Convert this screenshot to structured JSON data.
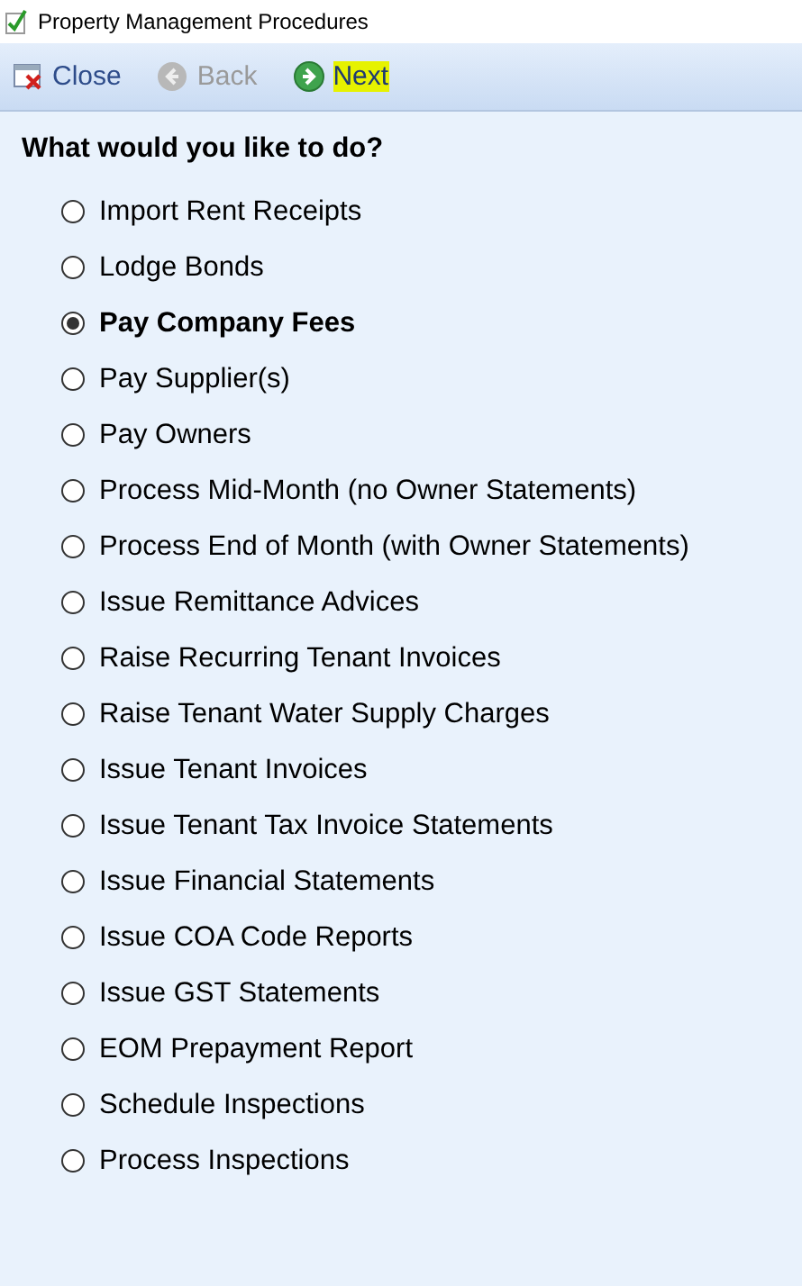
{
  "window": {
    "title": "Property Management Procedures"
  },
  "toolbar": [
    {
      "kind": "close",
      "label": "Close",
      "disabled": false,
      "highlighted": false
    },
    {
      "kind": "back",
      "label": "Back",
      "disabled": true,
      "highlighted": false
    },
    {
      "kind": "next",
      "label": "Next",
      "disabled": false,
      "highlighted": true
    }
  ],
  "heading": "What would you like to do?",
  "options": [
    {
      "label": "Import Rent Receipts",
      "selected": false
    },
    {
      "label": "Lodge Bonds",
      "selected": false
    },
    {
      "label": "Pay Company Fees",
      "selected": true
    },
    {
      "label": "Pay Supplier(s)",
      "selected": false
    },
    {
      "label": "Pay Owners",
      "selected": false
    },
    {
      "label": "Process Mid-Month (no Owner Statements)",
      "selected": false
    },
    {
      "label": "Process End of Month (with Owner Statements)",
      "selected": false
    },
    {
      "label": "Issue Remittance Advices",
      "selected": false
    },
    {
      "label": "Raise Recurring Tenant Invoices",
      "selected": false
    },
    {
      "label": "Raise Tenant Water Supply Charges",
      "selected": false
    },
    {
      "label": "Issue Tenant Invoices",
      "selected": false
    },
    {
      "label": "Issue Tenant Tax Invoice Statements",
      "selected": false
    },
    {
      "label": "Issue Financial Statements",
      "selected": false
    },
    {
      "label": "Issue COA Code Reports",
      "selected": false
    },
    {
      "label": "Issue GST Statements",
      "selected": false
    },
    {
      "label": "EOM Prepayment Report",
      "selected": false
    },
    {
      "label": "Schedule Inspections",
      "selected": false
    },
    {
      "label": "Process Inspections",
      "selected": false
    }
  ]
}
